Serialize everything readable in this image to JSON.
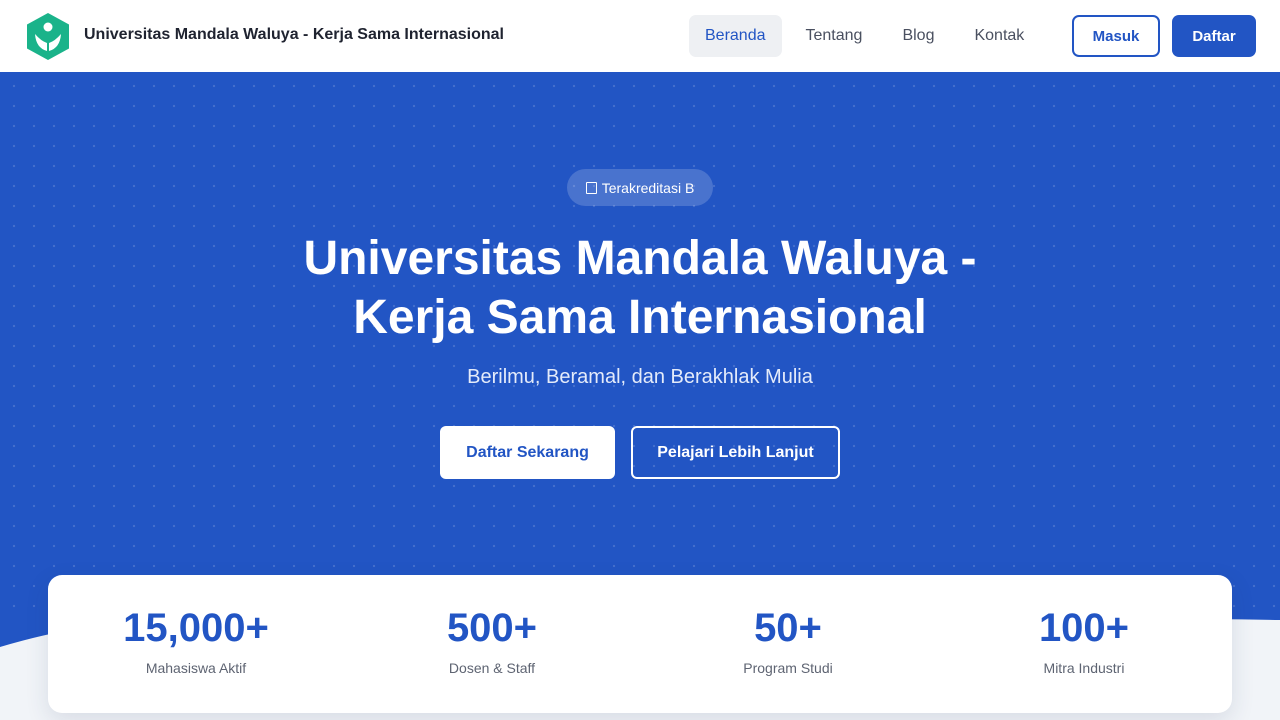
{
  "header": {
    "brand": "Universitas Mandala Waluya - Kerja Sama Internasional",
    "logo_icon": "shield-person-icon",
    "nav": [
      {
        "label": "Beranda",
        "active": true
      },
      {
        "label": "Tentang",
        "active": false
      },
      {
        "label": "Blog",
        "active": false
      },
      {
        "label": "Kontak",
        "active": false
      }
    ],
    "login_label": "Masuk",
    "register_label": "Daftar"
  },
  "hero": {
    "badge_icon": "document-icon",
    "badge_text": "Terakreditasi B",
    "title_line1": "Universitas Mandala Waluya -",
    "title_line2": "Kerja Sama Internasional",
    "subtitle": "Berilmu, Beramal, dan Berakhlak Mulia",
    "primary_cta": "Daftar Sekarang",
    "secondary_cta": "Pelajari Lebih Lanjut"
  },
  "stats": [
    {
      "value": "15,000+",
      "label": "Mahasiswa Aktif"
    },
    {
      "value": "500+",
      "label": "Dosen & Staff"
    },
    {
      "value": "50+",
      "label": "Program Studi"
    },
    {
      "value": "100+",
      "label": "Mitra Industri"
    }
  ],
  "colors": {
    "primary": "#2255c4",
    "logo_green": "#1ab38a",
    "background": "#f1f4f8",
    "text_dark": "#1f2330"
  }
}
